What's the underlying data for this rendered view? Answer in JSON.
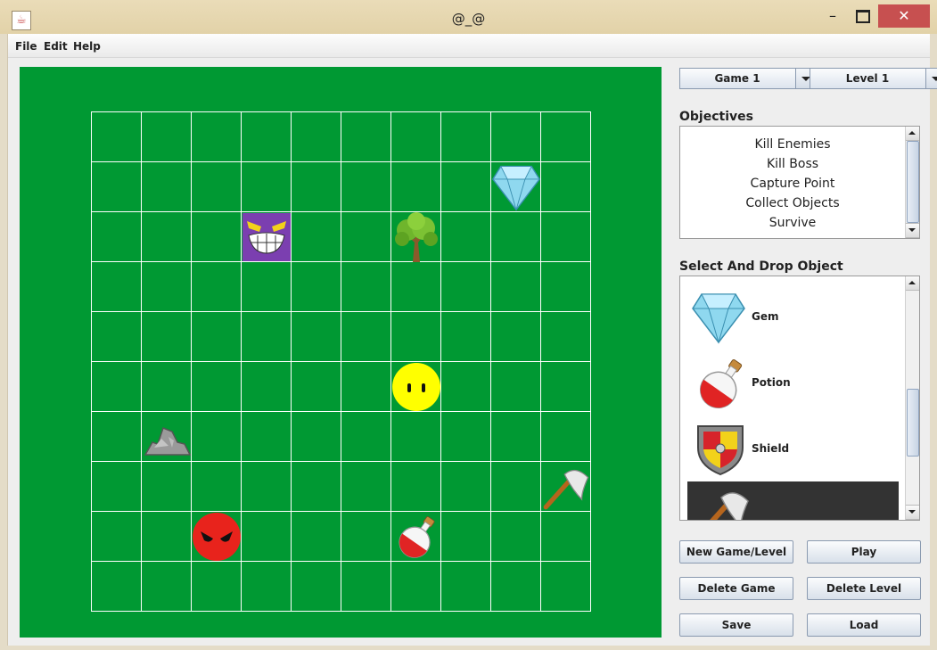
{
  "window": {
    "title": "@_@",
    "minimize_glyph": "–",
    "close_glyph": "✕"
  },
  "menu": {
    "items": [
      "File",
      "Edit",
      "Help"
    ]
  },
  "board": {
    "background_color": "#009933",
    "grid_line_color": "#ffffff",
    "rows": 10,
    "cols": 10,
    "objects": [
      {
        "type": "gem",
        "row": 1,
        "col": 8
      },
      {
        "type": "enemy-purple",
        "row": 2,
        "col": 3
      },
      {
        "type": "tree",
        "row": 2,
        "col": 6
      },
      {
        "type": "player-yellow",
        "row": 5,
        "col": 6
      },
      {
        "type": "rock",
        "row": 6,
        "col": 1
      },
      {
        "type": "axe",
        "row": 7,
        "col": 9
      },
      {
        "type": "boss-red",
        "row": 8,
        "col": 2
      },
      {
        "type": "potion",
        "row": 8,
        "col": 6
      }
    ]
  },
  "controls": {
    "game_select": {
      "value": "Game 1"
    },
    "level_select": {
      "value": "Level 1"
    }
  },
  "objectives": {
    "heading": "Objectives",
    "items": [
      "Kill Enemies",
      "Kill Boss",
      "Capture Point",
      "Collect Objects",
      "Survive"
    ]
  },
  "palette": {
    "heading": "Select And Drop Object",
    "items": [
      {
        "label": "Gem",
        "icon": "gem-icon"
      },
      {
        "label": "Potion",
        "icon": "potion-icon"
      },
      {
        "label": "Shield",
        "icon": "shield-icon"
      },
      {
        "label": "",
        "icon": "axe-icon",
        "selected": true
      }
    ],
    "selected_color": "#333333"
  },
  "buttons": {
    "new_game_level": "New Game/Level",
    "play": "Play",
    "delete_game": "Delete Game",
    "delete_level": "Delete Level",
    "save": "Save",
    "load": "Load"
  }
}
